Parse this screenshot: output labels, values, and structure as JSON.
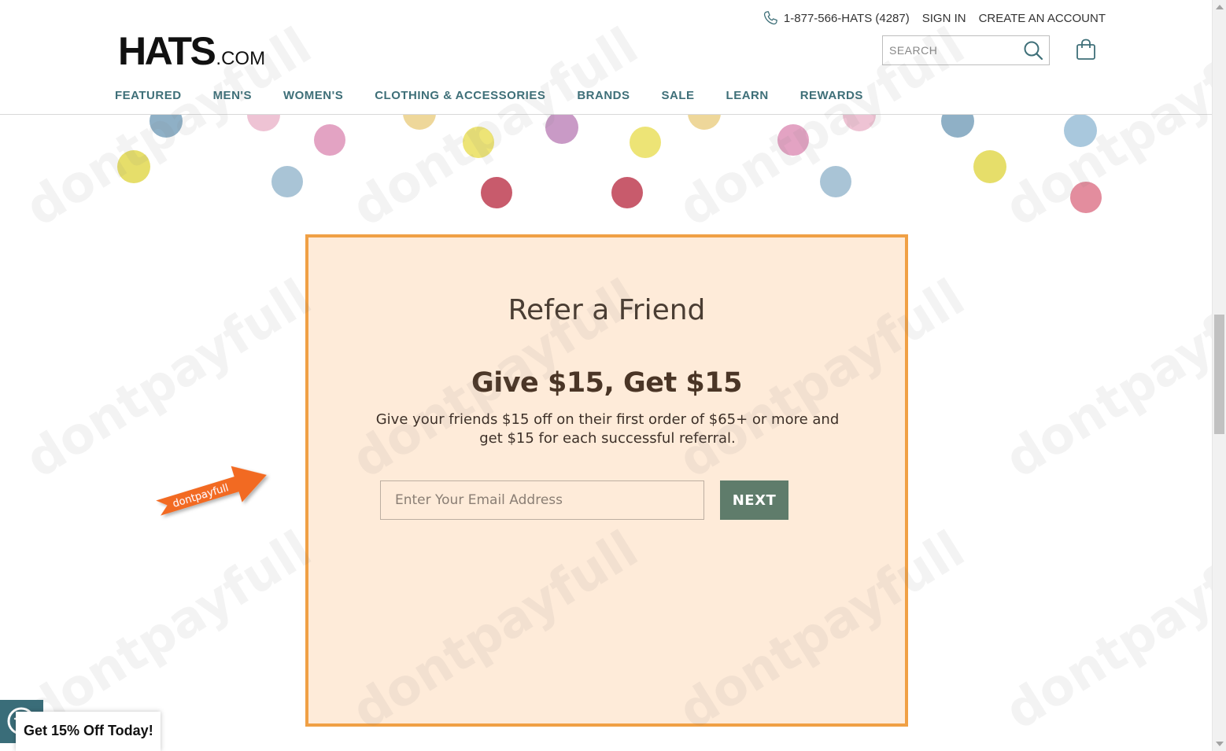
{
  "header": {
    "phone": "1-877-566-HATS (4287)",
    "sign_in": "SIGN IN",
    "create_account": "CREATE AN ACCOUNT",
    "logo_main": "HATS",
    "logo_suffix": ".COM",
    "search_placeholder": "SEARCH",
    "nav": [
      "FEATURED",
      "MEN'S",
      "WOMEN'S",
      "CLOTHING & ACCESSORIES",
      "BRANDS",
      "SALE",
      "LEARN",
      "REWARDS"
    ]
  },
  "icons": {
    "phone": "phone-icon",
    "search": "search-icon",
    "cart": "shopping-bag-icon",
    "accessibility": "accessibility-icon"
  },
  "refer": {
    "title": "Refer a Friend",
    "offer": "Give $15, Get $15",
    "description": "Give your friends $15 off on their first order of $65+ or more and get $15 for each successful referral.",
    "email_placeholder": "Enter Your Email Address",
    "next_label": "NEXT"
  },
  "promo": {
    "label": "Get 15% Off Today!"
  },
  "overlay": {
    "watermark_text": "dontpayfull",
    "arrow_text": "dontpayfull"
  },
  "colors": {
    "accent_nav": "#3e6f78",
    "panel_border": "#f0a045",
    "panel_background": "#feebd9",
    "next_button": "#5f7c6b"
  }
}
